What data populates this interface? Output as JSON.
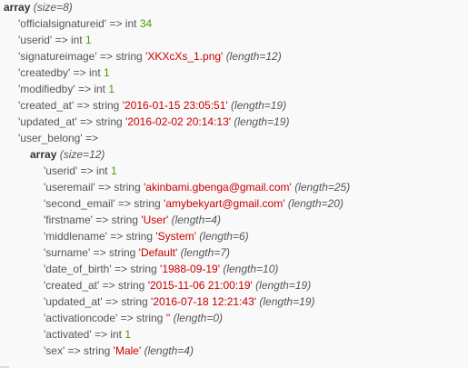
{
  "dump": {
    "root": {
      "array_word": "array",
      "size_text": "(size=8)",
      "entries": [
        {
          "key": "'officialsignatureid'",
          "arrow": "=>",
          "type": "int",
          "value": "34",
          "kind": "int",
          "length": ""
        },
        {
          "key": "'userid'",
          "arrow": "=>",
          "type": "int",
          "value": "1",
          "kind": "int",
          "length": ""
        },
        {
          "key": "'signatureimage'",
          "arrow": "=>",
          "type": "string",
          "value": "'XKXcXs_1.png'",
          "kind": "str",
          "length": "(length=12)"
        },
        {
          "key": "'createdby'",
          "arrow": "=>",
          "type": "int",
          "value": "1",
          "kind": "int",
          "length": ""
        },
        {
          "key": "'modifiedby'",
          "arrow": "=>",
          "type": "int",
          "value": "1",
          "kind": "int",
          "length": ""
        },
        {
          "key": "'created_at'",
          "arrow": "=>",
          "type": "string",
          "value": "'2016-01-15 23:05:51'",
          "kind": "str",
          "length": "(length=19)"
        },
        {
          "key": "'updated_at'",
          "arrow": "=>",
          "type": "string",
          "value": "'2016-02-02 20:14:13'",
          "kind": "str",
          "length": "(length=19)"
        }
      ],
      "nested_key": "'user_belong'",
      "nested_arrow": "=>"
    },
    "nested": {
      "array_word": "array",
      "size_text": "(size=12)",
      "entries": [
        {
          "key": "'userid'",
          "arrow": "=>",
          "type": "int",
          "value": "1",
          "kind": "int",
          "length": ""
        },
        {
          "key": "'useremail'",
          "arrow": "=>",
          "type": "string",
          "value": "'akinbami.gbenga@gmail.com'",
          "kind": "str",
          "length": "(length=25)"
        },
        {
          "key": "'second_email'",
          "arrow": "=>",
          "type": "string",
          "value": "'amybekyart@gmail.com'",
          "kind": "str",
          "length": "(length=20)"
        },
        {
          "key": "'firstname'",
          "arrow": "=>",
          "type": "string",
          "value": "'User'",
          "kind": "str",
          "length": "(length=4)"
        },
        {
          "key": "'middlename'",
          "arrow": "=>",
          "type": "string",
          "value": "'System'",
          "kind": "str",
          "length": "(length=6)"
        },
        {
          "key": "'surname'",
          "arrow": "=>",
          "type": "string",
          "value": "'Default'",
          "kind": "str",
          "length": "(length=7)"
        },
        {
          "key": "'date_of_birth'",
          "arrow": "=>",
          "type": "string",
          "value": "'1988-09-19'",
          "kind": "str",
          "length": "(length=10)"
        },
        {
          "key": "'created_at'",
          "arrow": "=>",
          "type": "string",
          "value": "'2015-11-06 21:00:19'",
          "kind": "str",
          "length": "(length=19)"
        },
        {
          "key": "'updated_at'",
          "arrow": "=>",
          "type": "string",
          "value": "'2016-07-18 12:21:43'",
          "kind": "str",
          "length": "(length=19)"
        },
        {
          "key": "'activationcode'",
          "arrow": "=>",
          "type": "string",
          "value": "''",
          "kind": "str",
          "length": "(length=0)"
        },
        {
          "key": "'activated'",
          "arrow": "=>",
          "type": "int",
          "value": "1",
          "kind": "int",
          "length": ""
        },
        {
          "key": "'sex'",
          "arrow": "=>",
          "type": "string",
          "value": "'Male'",
          "kind": "str",
          "length": "(length=4)"
        }
      ]
    },
    "colors": {
      "background": "#f9f9f9",
      "text": "#555555",
      "int_value": "#4e9a06",
      "string_value": "#cc0000"
    }
  }
}
